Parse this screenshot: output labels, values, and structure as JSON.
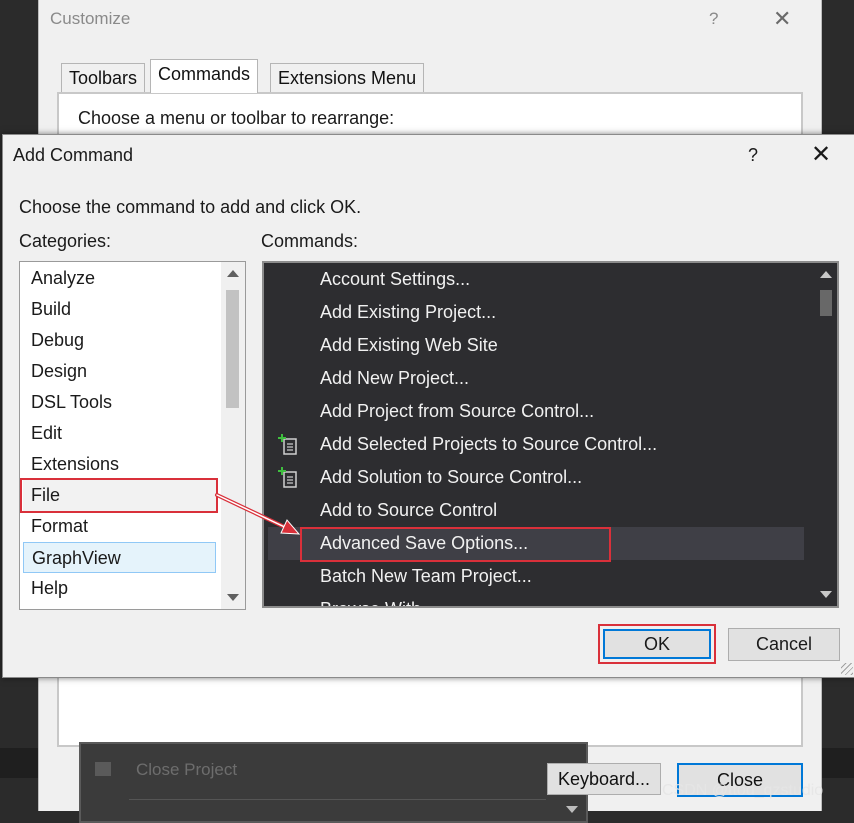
{
  "customize": {
    "title": "Customize",
    "help": "?",
    "close": "✕",
    "tabs": [
      {
        "label": "Toolbars"
      },
      {
        "label": "Commands"
      },
      {
        "label": "Extensions Menu"
      }
    ],
    "panel_label": "Choose a menu or toolbar to rearrange:",
    "ghost_item": "Close Project",
    "keyboard_button": "Keyboard...",
    "close_button": "Close"
  },
  "add_command": {
    "title": "Add Command",
    "help": "?",
    "close": "✕",
    "instruction": "Choose the command to add and click OK.",
    "categories_label": "Categories:",
    "commands_label": "Commands:",
    "categories": [
      "Analyze",
      "Build",
      "Debug",
      "Design",
      "DSL Tools",
      "Edit",
      "Extensions",
      "File",
      "Format",
      "GraphView",
      "Help"
    ],
    "selected_category": "GraphView",
    "highlighted_category": "File",
    "commands": [
      {
        "label": "Account Settings...",
        "icon": ""
      },
      {
        "label": "Add Existing Project...",
        "icon": ""
      },
      {
        "label": "Add Existing Web Site",
        "icon": ""
      },
      {
        "label": "Add New Project...",
        "icon": ""
      },
      {
        "label": "Add Project from Source Control...",
        "icon": ""
      },
      {
        "label": "Add Selected Projects to Source Control...",
        "icon": "add-to-source-control-icon"
      },
      {
        "label": "Add Solution to Source Control...",
        "icon": "add-to-source-control-icon"
      },
      {
        "label": "Add to Source Control",
        "icon": ""
      },
      {
        "label": "Advanced Save Options...",
        "icon": ""
      },
      {
        "label": "Batch New Team Project...",
        "icon": ""
      },
      {
        "label": "Browse With...",
        "icon": ""
      }
    ],
    "selected_command": "Advanced Save Options...",
    "ok_button": "OK",
    "cancel_button": "Cancel"
  },
  "annotation_color": "#d9303a",
  "watermark": "CSDN @ttod_qzstudio"
}
